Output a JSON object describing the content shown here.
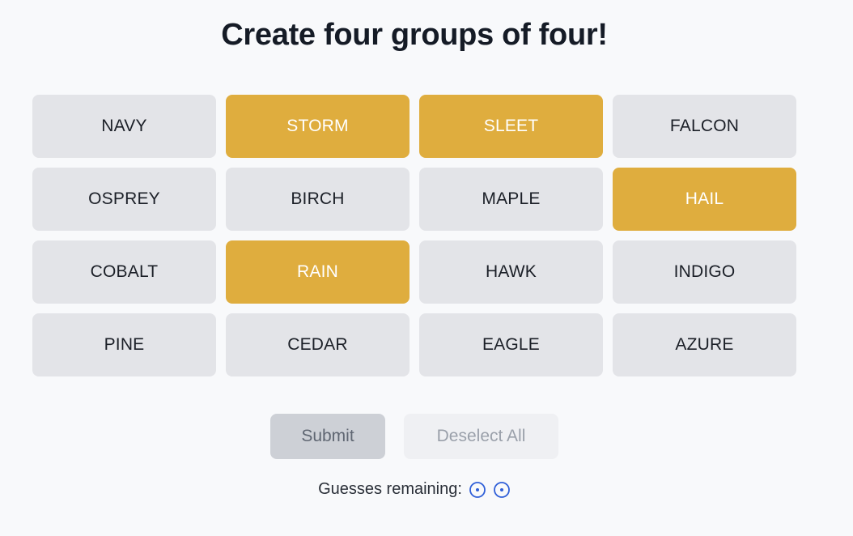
{
  "title": "Create four groups of four!",
  "tiles": [
    {
      "label": "NAVY",
      "selected": false
    },
    {
      "label": "STORM",
      "selected": true
    },
    {
      "label": "SLEET",
      "selected": true
    },
    {
      "label": "FALCON",
      "selected": false
    },
    {
      "label": "OSPREY",
      "selected": false
    },
    {
      "label": "BIRCH",
      "selected": false
    },
    {
      "label": "MAPLE",
      "selected": false
    },
    {
      "label": "HAIL",
      "selected": true
    },
    {
      "label": "COBALT",
      "selected": false
    },
    {
      "label": "RAIN",
      "selected": true
    },
    {
      "label": "HAWK",
      "selected": false
    },
    {
      "label": "INDIGO",
      "selected": false
    },
    {
      "label": "PINE",
      "selected": false
    },
    {
      "label": "CEDAR",
      "selected": false
    },
    {
      "label": "EAGLE",
      "selected": false
    },
    {
      "label": "AZURE",
      "selected": false
    }
  ],
  "controls": {
    "submit_label": "Submit",
    "deselect_label": "Deselect All"
  },
  "guesses": {
    "label": "Guesses remaining:",
    "remaining": 2,
    "icon": "target-circle-icon"
  },
  "colors": {
    "selected_tile": "#dfad3e",
    "tile": "#e3e4e8",
    "guess_icon": "#2f5fd8"
  }
}
